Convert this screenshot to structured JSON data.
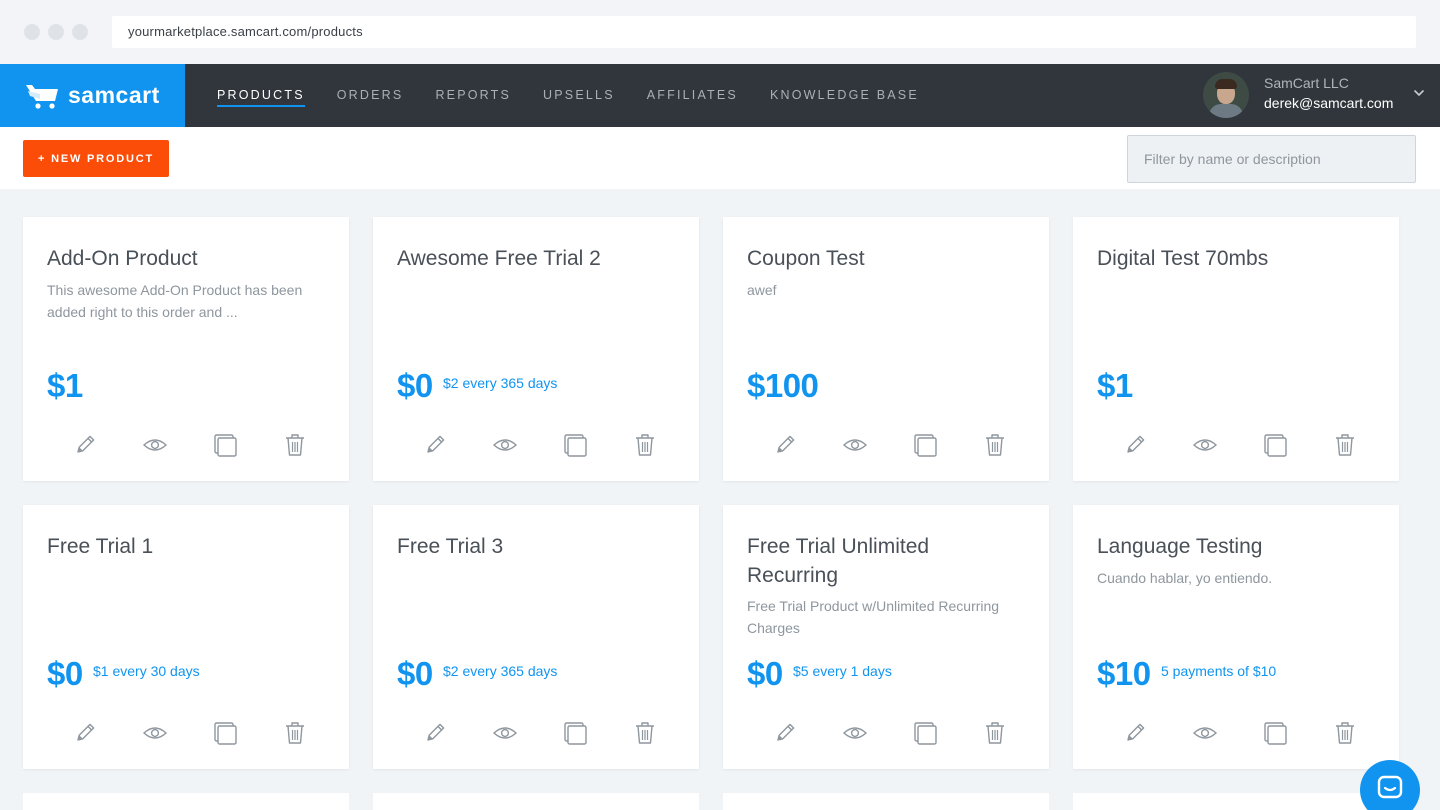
{
  "browser": {
    "url": "yourmarketplace.samcart.com/products"
  },
  "brand": {
    "name": "samcart",
    "color": "#1194ef"
  },
  "nav": {
    "items": [
      {
        "label": "PRODUCTS",
        "active": true
      },
      {
        "label": "ORDERS",
        "active": false
      },
      {
        "label": "REPORTS",
        "active": false
      },
      {
        "label": "UPSELLS",
        "active": false
      },
      {
        "label": "AFFILIATES",
        "active": false
      },
      {
        "label": "KNOWLEDGE BASE",
        "active": false
      }
    ]
  },
  "account": {
    "name": "SamCart LLC",
    "email": "derek@samcart.com"
  },
  "toolbar": {
    "new_product_label": "+ NEW PRODUCT",
    "new_product_color": "#fb4d08",
    "filter_placeholder": "Filter by name or description"
  },
  "products": [
    {
      "title": "Add-On Product",
      "description": "This awesome Add-On Product has been added right to this order and ...",
      "price": "$1",
      "recurring": ""
    },
    {
      "title": "Awesome Free Trial 2",
      "description": "",
      "price": "$0",
      "recurring": "$2 every 365 days"
    },
    {
      "title": "Coupon Test",
      "description": "awef",
      "price": "$100",
      "recurring": ""
    },
    {
      "title": "Digital Test 70mbs",
      "description": "",
      "price": "$1",
      "recurring": ""
    },
    {
      "title": "Free Trial 1",
      "description": "",
      "price": "$0",
      "recurring": "$1 every 30 days"
    },
    {
      "title": "Free Trial 3",
      "description": "",
      "price": "$0",
      "recurring": "$2 every 365 days"
    },
    {
      "title": "Free Trial Unlimited Recurring",
      "description": "Free Trial Product w/Unlimited Recurring Charges",
      "price": "$0",
      "recurring": "$5 every 1 days"
    },
    {
      "title": "Language Testing",
      "description": "Cuando hablar, yo entiendo.",
      "price": "$10",
      "recurring": "5 payments of $10"
    }
  ],
  "card_actions": [
    "pencil-icon",
    "eye-icon",
    "copy-icon",
    "trash-icon"
  ]
}
